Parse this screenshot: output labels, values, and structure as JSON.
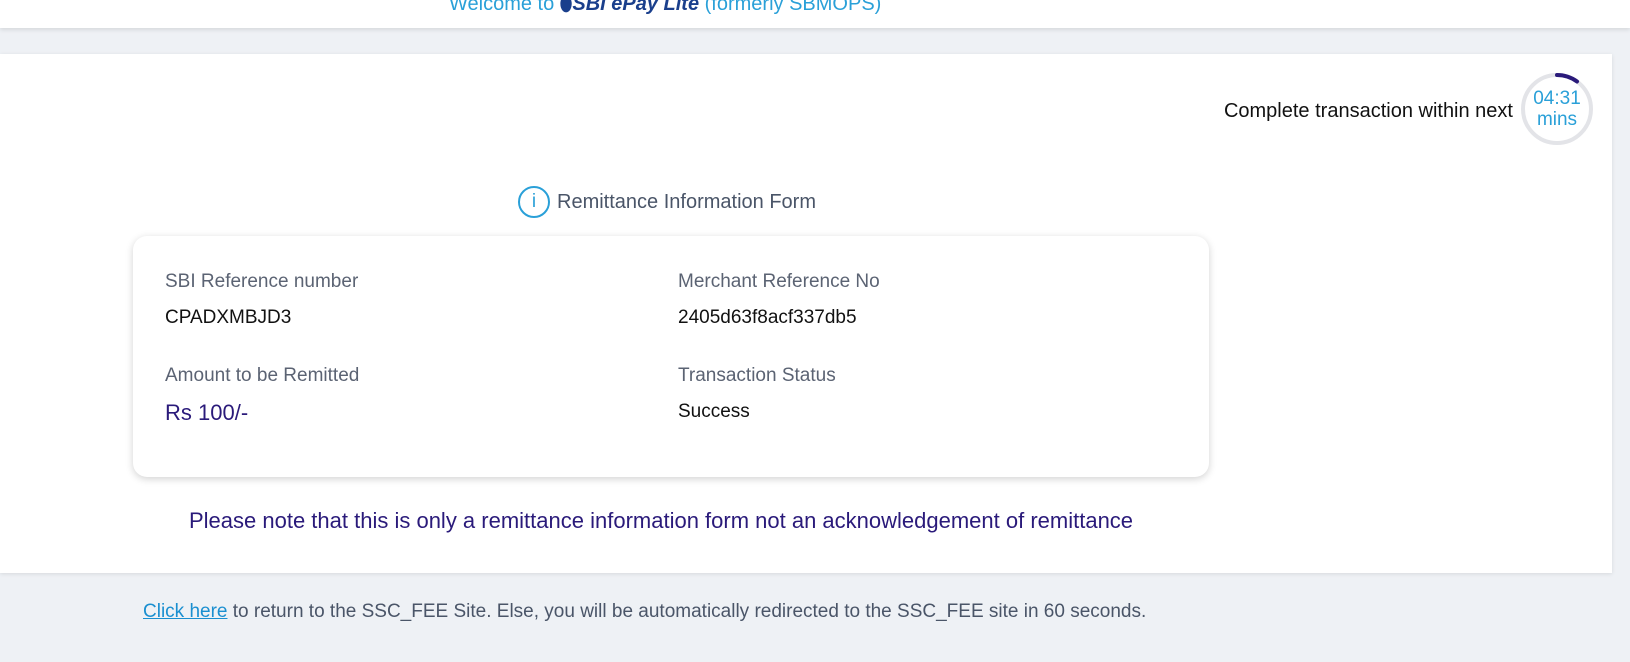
{
  "header": {
    "welcome_prefix": "Welcome to",
    "brand_icon": "⬮",
    "brand_name": "SBI ePay Lite",
    "welcome_suffix": "(formerly SBMOPS)"
  },
  "timer": {
    "label": "Complete transaction within next",
    "time": "04:31",
    "unit": "mins",
    "remaining_fraction": 0.1,
    "ring_color": "#2a1a7a",
    "track_color": "#e3e4e8"
  },
  "form": {
    "icon": "info-icon",
    "icon_glyph": "i",
    "title": "Remittance Information Form",
    "fields": [
      {
        "label": "SBI Reference number",
        "value": "CPADXMBJD3"
      },
      {
        "label": "Merchant Reference No",
        "value": "2405d63f8acf337db5"
      },
      {
        "label": "Amount to be Remitted",
        "value": "Rs 100/-"
      },
      {
        "label": "Transaction Status",
        "value": "Success"
      }
    ]
  },
  "note": "Please note that this is only a remittance information form not an acknowledgement of remittance",
  "footer": {
    "link_text": "Click here",
    "text": " to return to the SSC_FEE Site. Else, you will be automatically redirected to the SSC_FEE site in 60 seconds."
  }
}
